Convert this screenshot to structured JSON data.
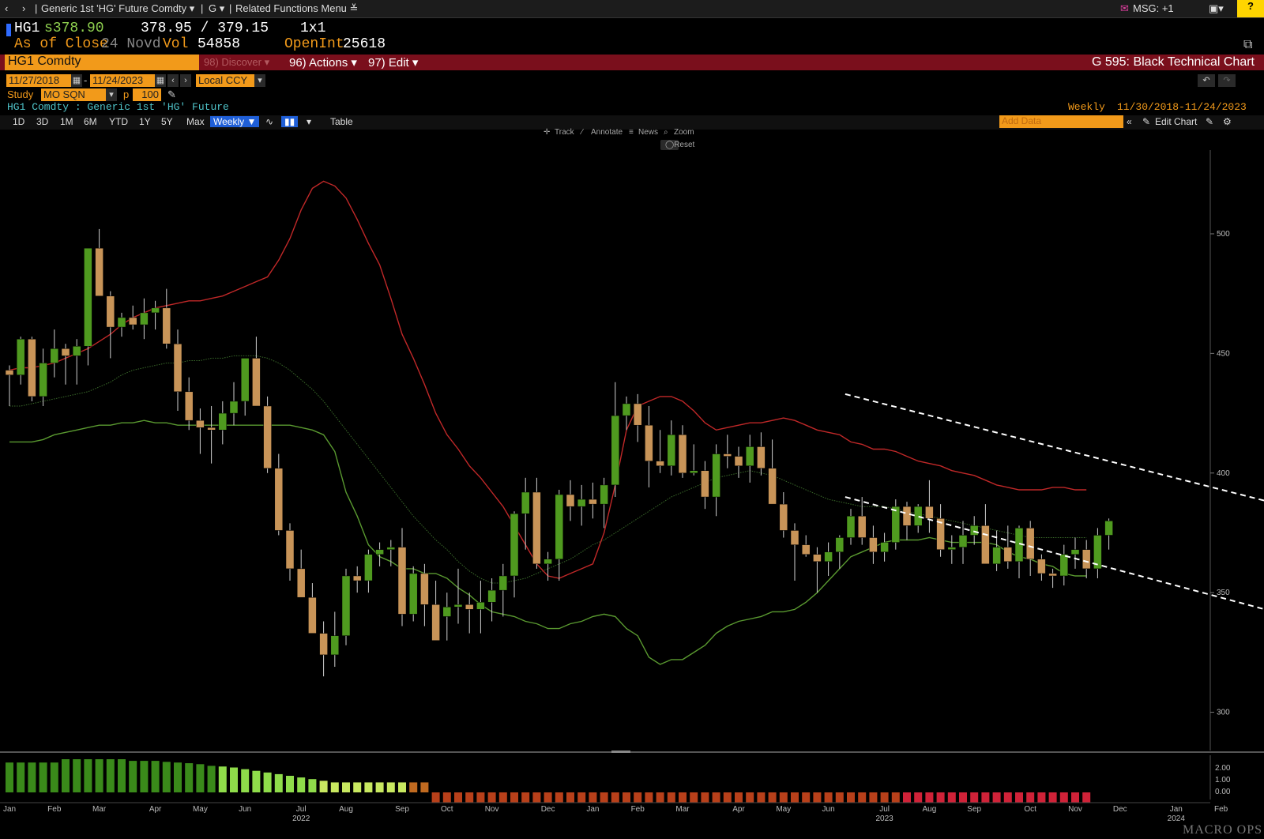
{
  "nav": {
    "back_icon": "chevron-left-icon",
    "fwd_icon": "chevron-right-icon",
    "security_menu": "Generic 1st 'HG' Future Comdty ▾",
    "g_menu": "G ▾",
    "related_menu": "Related Functions Menu ≚",
    "msg": "MSG: +1",
    "help": "?"
  },
  "quote": {
    "ticker": "HG1",
    "last": "s378.90",
    "bid_ask": "378.95 / 379.15",
    "size": "1x1",
    "as_of_label": "As of Close",
    "as_of_date": "24 Novd",
    "vol_label": "Vol",
    "vol_value": "54858",
    "oi_label": "OpenInt",
    "oi_value": "25618"
  },
  "redbar": {
    "security": "HG1 Comdty",
    "discover": "98) Discover ▾",
    "actions": "96) Actions ▾",
    "edit": "97) Edit ▾",
    "chart_title": "G 595: Black Technical Chart"
  },
  "dates": {
    "start": "11/27/2018",
    "end": "11/24/2023",
    "ccy": "Local CCY"
  },
  "study": {
    "label": "Study",
    "value": "MO SQN",
    "p_label": "p",
    "p_value": "100"
  },
  "subtitle": {
    "security_desc": "HG1 Comdty : Generic 1st 'HG' Future",
    "period": "Weekly",
    "range": "11/30/2018-11/24/2023"
  },
  "toolbar": {
    "ranges": [
      "1D",
      "3D",
      "1M",
      "6M",
      "YTD",
      "1Y",
      "5Y",
      "Max"
    ],
    "frequency": "Weekly ▼",
    "table": "Table",
    "add_data": "Add Data",
    "edit_chart": "Edit Chart"
  },
  "hints": {
    "track": "Track",
    "annotate": "Annotate",
    "news": "News",
    "zoom": "Zoom",
    "reset": "Reset"
  },
  "watermark": "MACRO OPS",
  "colors": {
    "up": "#4f9a1f",
    "down": "#c89458",
    "upper_band": "#c02828",
    "lower_band": "#5a9a30",
    "mid_band": "#3a6a2a",
    "trend": "#ffffff",
    "accent": "#f29a1a",
    "header_red": "#7a0f1c"
  },
  "chart_data": {
    "type": "candlestick",
    "frequency": "weekly",
    "y_ticks": [
      300,
      350,
      400,
      450,
      500
    ],
    "ylim": [
      284,
      535
    ],
    "months": [
      {
        "label": "Jan",
        "i": 0
      },
      {
        "label": "Feb",
        "i": 4
      },
      {
        "label": "Mar",
        "i": 8
      },
      {
        "label": "Apr",
        "i": 13
      },
      {
        "label": "May",
        "i": 17
      },
      {
        "label": "Jun",
        "i": 21
      },
      {
        "label": "Jul",
        "i": 26
      },
      {
        "label": "Aug",
        "i": 30
      },
      {
        "label": "Sep",
        "i": 35
      },
      {
        "label": "Oct",
        "i": 39
      },
      {
        "label": "Nov",
        "i": 43
      },
      {
        "label": "Dec",
        "i": 48
      },
      {
        "label": "Jan",
        "i": 52
      },
      {
        "label": "Feb",
        "i": 56
      },
      {
        "label": "Mar",
        "i": 60
      },
      {
        "label": "Apr",
        "i": 65
      },
      {
        "label": "May",
        "i": 69
      },
      {
        "label": "Jun",
        "i": 73
      },
      {
        "label": "Jul",
        "i": 78
      },
      {
        "label": "Aug",
        "i": 82
      },
      {
        "label": "Sep",
        "i": 86
      },
      {
        "label": "Oct",
        "i": 91
      },
      {
        "label": "Nov",
        "i": 95
      },
      {
        "label": "Dec",
        "i": 99
      },
      {
        "label": "Jan",
        "i": 104
      },
      {
        "label": "Feb",
        "i": 108
      }
    ],
    "years": [
      {
        "label": "2022",
        "i": 26
      },
      {
        "label": "2023",
        "i": 78
      },
      {
        "label": "2024",
        "i": 104
      }
    ],
    "candles": [
      [
        443,
        445,
        428,
        441
      ],
      [
        441,
        457,
        437,
        456
      ],
      [
        456,
        457,
        430,
        432
      ],
      [
        432,
        452,
        428,
        446
      ],
      [
        446,
        460,
        440,
        452
      ],
      [
        452,
        454,
        437,
        449
      ],
      [
        449,
        456,
        437,
        453
      ],
      [
        453,
        493,
        445,
        494
      ],
      [
        494,
        502,
        474,
        474
      ],
      [
        474,
        476,
        448,
        461
      ],
      [
        461,
        467,
        457,
        465
      ],
      [
        465,
        470,
        460,
        462
      ],
      [
        462,
        473,
        456,
        467
      ],
      [
        467,
        472,
        460,
        469
      ],
      [
        469,
        477,
        452,
        454
      ],
      [
        454,
        460,
        426,
        434
      ],
      [
        434,
        440,
        418,
        422
      ],
      [
        422,
        427,
        408,
        419
      ],
      [
        419,
        428,
        404,
        418
      ],
      [
        418,
        430,
        412,
        425
      ],
      [
        425,
        438,
        420,
        430
      ],
      [
        430,
        445,
        424,
        448
      ],
      [
        448,
        457,
        430,
        428
      ],
      [
        428,
        432,
        400,
        402
      ],
      [
        402,
        408,
        374,
        376
      ],
      [
        376,
        379,
        355,
        360
      ],
      [
        360,
        368,
        350,
        348
      ],
      [
        348,
        354,
        334,
        333
      ],
      [
        333,
        338,
        315,
        324
      ],
      [
        324,
        342,
        319,
        332
      ],
      [
        332,
        360,
        328,
        357
      ],
      [
        357,
        361,
        350,
        355
      ],
      [
        355,
        368,
        350,
        366
      ],
      [
        366,
        371,
        361,
        368
      ],
      [
        368,
        372,
        361,
        369
      ],
      [
        369,
        377,
        336,
        341
      ],
      [
        341,
        361,
        338,
        358
      ],
      [
        358,
        362,
        336,
        345
      ],
      [
        345,
        355,
        334,
        330
      ],
      [
        340,
        350,
        330,
        344
      ],
      [
        344,
        360,
        337,
        345
      ],
      [
        345,
        350,
        333,
        343
      ],
      [
        343,
        355,
        333,
        346
      ],
      [
        346,
        356,
        338,
        351
      ],
      [
        351,
        362,
        340,
        357
      ],
      [
        357,
        384,
        348,
        383
      ],
      [
        383,
        398,
        368,
        392
      ],
      [
        392,
        398,
        360,
        362
      ],
      [
        362,
        367,
        355,
        364
      ],
      [
        364,
        393,
        355,
        391
      ],
      [
        391,
        397,
        380,
        386
      ],
      [
        386,
        395,
        378,
        389
      ],
      [
        389,
        396,
        381,
        387
      ],
      [
        387,
        398,
        377,
        395
      ],
      [
        395,
        438,
        390,
        424
      ],
      [
        424,
        432,
        418,
        429
      ],
      [
        429,
        433,
        413,
        420
      ],
      [
        420,
        428,
        394,
        405
      ],
      [
        405,
        418,
        400,
        403
      ],
      [
        403,
        422,
        399,
        416
      ],
      [
        416,
        420,
        398,
        400
      ],
      [
        400,
        412,
        399,
        401
      ],
      [
        401,
        405,
        385,
        390
      ],
      [
        390,
        412,
        382,
        408
      ],
      [
        408,
        416,
        402,
        407
      ],
      [
        407,
        411,
        398,
        403
      ],
      [
        403,
        416,
        396,
        411
      ],
      [
        411,
        417,
        399,
        402
      ],
      [
        402,
        414,
        390,
        387
      ],
      [
        387,
        392,
        373,
        376
      ],
      [
        376,
        379,
        355,
        370
      ],
      [
        370,
        374,
        365,
        366
      ],
      [
        366,
        369,
        350,
        363
      ],
      [
        363,
        371,
        357,
        367
      ],
      [
        367,
        374,
        360,
        373
      ],
      [
        373,
        385,
        370,
        382
      ],
      [
        382,
        390,
        370,
        373
      ],
      [
        373,
        378,
        362,
        367
      ],
      [
        367,
        375,
        363,
        371
      ],
      [
        371,
        389,
        368,
        386
      ],
      [
        386,
        388,
        372,
        378
      ],
      [
        378,
        387,
        375,
        386
      ],
      [
        386,
        397,
        375,
        381
      ],
      [
        381,
        387,
        365,
        368
      ],
      [
        368,
        374,
        362,
        369
      ],
      [
        369,
        380,
        362,
        374
      ],
      [
        374,
        382,
        370,
        378
      ],
      [
        378,
        387,
        363,
        362
      ],
      [
        362,
        376,
        359,
        369
      ],
      [
        369,
        378,
        360,
        363
      ],
      [
        363,
        378,
        356,
        377
      ],
      [
        377,
        380,
        357,
        364
      ],
      [
        364,
        366,
        355,
        358
      ],
      [
        358,
        360,
        352,
        357
      ],
      [
        357,
        370,
        353,
        366
      ],
      [
        366,
        373,
        360,
        368
      ],
      [
        368,
        372,
        356,
        360
      ],
      [
        360,
        377,
        356,
        374
      ],
      [
        374,
        381,
        368,
        380
      ]
    ],
    "upper_band": [
      443,
      444,
      444,
      445,
      446,
      448,
      450,
      452,
      455,
      458,
      462,
      465,
      467,
      469,
      470,
      471,
      472,
      472,
      473,
      474,
      476,
      478,
      480,
      482,
      489,
      498,
      510,
      519,
      522,
      520,
      515,
      506,
      496,
      487,
      473,
      458,
      448,
      437,
      425,
      416,
      410,
      403,
      398,
      392,
      386,
      378,
      370,
      362,
      357,
      356,
      358,
      360,
      362,
      375,
      395,
      418,
      428,
      430,
      432,
      432,
      430,
      426,
      421,
      418,
      419,
      420,
      421,
      421,
      422,
      423,
      422,
      420,
      418,
      417,
      416,
      413,
      412,
      410,
      410,
      409,
      407,
      405,
      404,
      403,
      401,
      400,
      399,
      397,
      395,
      394,
      393,
      393,
      393,
      394,
      394,
      393,
      393
    ],
    "lower_band": [
      413,
      413,
      413,
      414,
      416,
      417,
      418,
      419,
      420,
      420,
      421,
      421,
      422,
      421,
      421,
      420,
      420,
      420,
      420,
      420,
      420,
      420,
      420,
      420,
      420,
      420,
      419,
      418,
      416,
      409,
      392,
      382,
      370,
      365,
      363,
      360,
      360,
      358,
      358,
      356,
      352,
      349,
      345,
      342,
      341,
      340,
      338,
      337,
      335,
      335,
      337,
      338,
      340,
      341,
      340,
      335,
      332,
      323,
      320,
      322,
      322,
      325,
      328,
      333,
      336,
      338,
      339,
      340,
      342,
      342,
      343,
      346,
      350,
      355,
      360,
      365,
      367,
      369,
      371,
      372,
      372,
      372,
      373,
      372,
      371,
      371,
      371,
      371,
      370,
      367,
      365,
      364,
      362,
      361,
      358,
      357,
      357
    ],
    "mid_band": [
      428,
      428,
      429,
      430,
      431,
      432,
      433,
      434,
      436,
      438,
      441,
      443,
      444,
      445,
      446,
      446,
      447,
      447,
      448,
      448,
      449,
      449,
      449,
      448,
      446,
      443,
      439,
      435,
      430,
      424,
      418,
      412,
      406,
      400,
      394,
      388,
      382,
      377,
      372,
      368,
      363,
      359,
      356,
      354,
      354,
      355,
      356,
      358,
      360,
      362,
      364,
      367,
      370,
      372,
      375,
      378,
      381,
      384,
      387,
      390,
      392,
      394,
      396,
      398,
      399,
      400,
      401,
      400,
      399,
      397,
      395,
      393,
      391,
      389,
      388,
      387,
      386,
      386,
      386,
      385,
      384,
      383,
      382,
      381,
      380,
      379,
      378,
      377,
      376,
      375,
      374,
      373,
      373,
      373,
      373,
      373,
      373
    ],
    "trend_upper": [
      [
        74.5,
        433
      ],
      [
        121.5,
        377
      ]
    ],
    "trend_lower": [
      [
        74.5,
        390
      ],
      [
        117.5,
        336
      ]
    ],
    "indicator": [
      0.9,
      0.9,
      0.9,
      0.9,
      0.9,
      1.0,
      1.0,
      1.0,
      1.0,
      1.0,
      1.0,
      0.95,
      0.95,
      0.95,
      0.92,
      0.9,
      0.88,
      0.85,
      0.8,
      0.78,
      0.75,
      0.7,
      0.65,
      0.6,
      0.55,
      0.5,
      0.45,
      0.4,
      0.35,
      0.3,
      0.3,
      0.3,
      0.3,
      0.3,
      0.3,
      0.3,
      0.3,
      0.3,
      -0.3,
      -0.3,
      -0.3,
      -0.3,
      -0.3,
      -0.3,
      -0.3,
      -0.3,
      -0.3,
      -0.3,
      -0.3,
      -0.3,
      -0.3,
      -0.3,
      -0.3,
      -0.3,
      -0.3,
      -0.3,
      -0.3,
      -0.3,
      -0.3,
      -0.3,
      -0.3,
      -0.3,
      -0.3,
      -0.3,
      -0.3,
      -0.3,
      -0.3,
      -0.3,
      -0.3,
      -0.3,
      -0.3,
      -0.3,
      -0.3,
      -0.3,
      -0.3,
      -0.3,
      -0.3,
      -0.3,
      -0.3,
      -0.3,
      -0.3,
      -0.3,
      -0.3,
      -0.3,
      -0.3,
      -0.3,
      -0.3,
      -0.3,
      -0.3,
      -0.3,
      -0.3,
      -0.3,
      -0.3,
      -0.3,
      -0.3,
      -0.3,
      -0.3
    ],
    "indicator_ticks": [
      "2.00",
      "1.00",
      "0.00"
    ]
  }
}
